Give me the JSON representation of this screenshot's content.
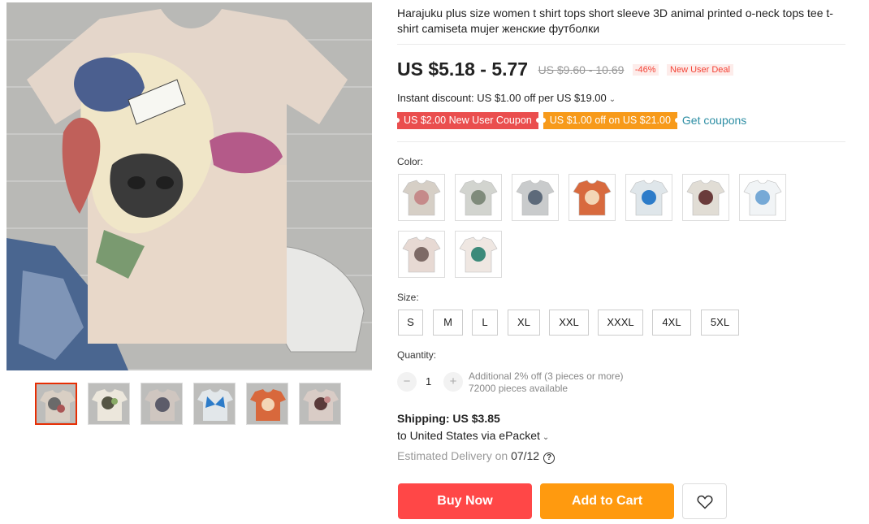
{
  "product": {
    "title": "Harajuku plus size women t shirt tops short sleeve 3D animal printed o-neck tops tee t-shirt camiseta mujer женские футболки"
  },
  "gallery": {
    "main_image": "cow-print-tshirt",
    "thumbnails": [
      {
        "name": "cow-print",
        "bg": "#b8b8b6"
      },
      {
        "name": "cow-white",
        "bg": "#c4c4c2"
      },
      {
        "name": "cow-grey",
        "bg": "#b1b1b0"
      },
      {
        "name": "butterfly",
        "bg": "#c2c2c0"
      },
      {
        "name": "corgi",
        "bg": "#c5c5c3"
      },
      {
        "name": "cow-pink",
        "bg": "#bbbbb9"
      }
    ]
  },
  "price": {
    "current": "US $5.18 - 5.77",
    "original": "US $9.60 - 10.69",
    "discount": "-46%",
    "deal": "New User Deal"
  },
  "instant_discount": "Instant discount: US $1.00 off per US $19.00",
  "coupons": {
    "new_user": "US $2.00 New User Coupon",
    "store": "US $1.00 off on US $21.00",
    "get_link": "Get coupons"
  },
  "color": {
    "label": "Color:",
    "options": [
      {
        "name": "cow-pink",
        "tee": "#d6cfc6",
        "accent": "#c58a8a"
      },
      {
        "name": "cow-grey",
        "tee": "#d2d4cf",
        "accent": "#7f8b7b"
      },
      {
        "name": "cow-dark",
        "tee": "#c9cbcc",
        "accent": "#5d6a7a"
      },
      {
        "name": "corgi",
        "tee": "#d86a3e",
        "accent": "#f3d6b6"
      },
      {
        "name": "butterfly-blue",
        "tee": "#dfe6ea",
        "accent": "#2d7cc9"
      },
      {
        "name": "cow-floral",
        "tee": "#e1ddd5",
        "accent": "#6a3b3b"
      },
      {
        "name": "butterfly-white",
        "tee": "#f1f4f6",
        "accent": "#76a9d6"
      },
      {
        "name": "cat-pink",
        "tee": "#e7d9d3",
        "accent": "#7d6a66"
      },
      {
        "name": "butterfly-pink",
        "tee": "#efe7e2",
        "accent": "#3c8a7a"
      }
    ]
  },
  "size": {
    "label": "Size:",
    "options": [
      "S",
      "M",
      "L",
      "XL",
      "XXL",
      "XXXL",
      "4XL",
      "5XL"
    ]
  },
  "quantity": {
    "label": "Quantity:",
    "value": "1",
    "minus": "−",
    "plus": "+",
    "note": "Additional 2% off (3 pieces or more)",
    "available": "72000 pieces available"
  },
  "shipping": {
    "cost": "Shipping: US $3.85",
    "destination": "to United States via ePacket",
    "estimate_label": "Estimated Delivery on",
    "estimate_date": "07/12",
    "info_icon": "question-icon"
  },
  "actions": {
    "buy_now": "Buy Now",
    "add_to_cart": "Add to Cart",
    "wishlist_icon": "heart-icon"
  },
  "colors": {
    "accent_red": "#ff4747",
    "accent_orange": "#ff9a0f",
    "coupon_red": "#ea4e4e",
    "coupon_orange": "#f79a1a",
    "link": "#2d8ea4"
  }
}
